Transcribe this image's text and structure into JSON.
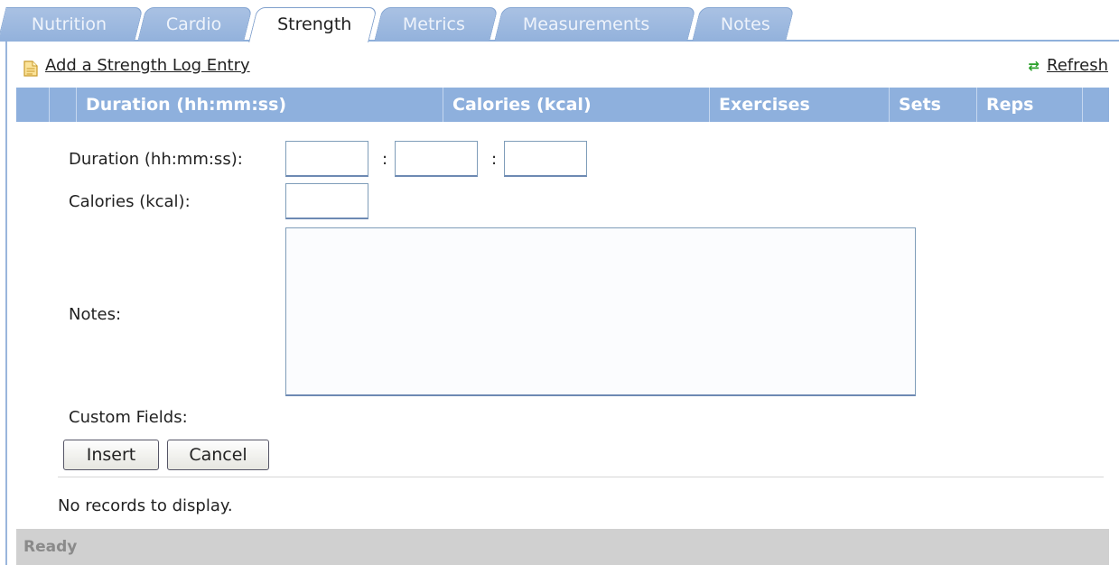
{
  "tabs": [
    {
      "label": "Nutrition",
      "active": false
    },
    {
      "label": "Cardio",
      "active": false
    },
    {
      "label": "Strength",
      "active": true
    },
    {
      "label": "Metrics",
      "active": false
    },
    {
      "label": "Measurements",
      "active": false
    },
    {
      "label": "Notes",
      "active": false
    }
  ],
  "toolbar": {
    "add_label": "Add a Strength Log Entry",
    "refresh_label": "Refresh"
  },
  "grid": {
    "columns": [
      "Duration (hh:mm:ss)",
      "Calories (kcal)",
      "Exercises",
      "Sets",
      "Reps"
    ]
  },
  "form": {
    "duration_label": "Duration (hh:mm:ss):",
    "duration_separator": ":",
    "duration_hours": "",
    "duration_minutes": "",
    "duration_seconds": "",
    "calories_label": "Calories (kcal):",
    "calories_value": "",
    "notes_label": "Notes:",
    "notes_value": "",
    "custom_fields_label": "Custom Fields:",
    "insert_label": "Insert",
    "cancel_label": "Cancel"
  },
  "empty_message": "No records to display.",
  "status_text": "Ready",
  "colors": {
    "tab_inactive": "#93b2dc",
    "header_bg": "#8eb0dd",
    "status_bg": "#d0d0d0"
  }
}
